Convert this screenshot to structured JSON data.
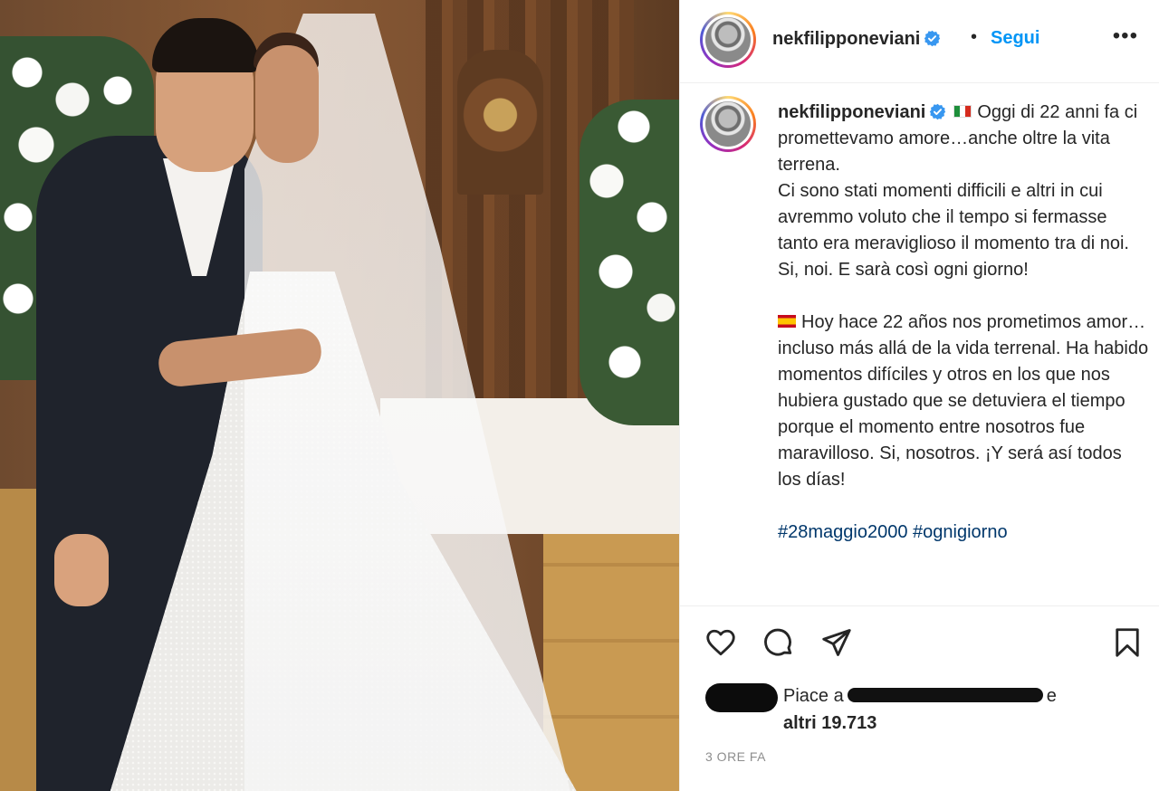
{
  "post": {
    "username": "nekfilipponeviani",
    "separator": "•",
    "follow_label": "Segui",
    "more_label": "•••"
  },
  "caption": {
    "username": "nekfilipponeviani",
    "flag_it": "italy-flag-icon",
    "it_lines": [
      "Oggi di 22 anni fa ci promettevamo amore…anche oltre la vita terrena.",
      "Ci sono stati momenti difficili e altri in cui avremmo voluto che il tempo si fermasse tanto era meraviglioso il momento tra di noi. Si, noi. E sarà così ogni giorno!"
    ],
    "flag_es": "spain-flag-icon",
    "es_text": "Hoy hace 22 años nos prometimos amor… incluso más allá de la vida terrenal. Ha habido momentos difíciles y otros en los que nos hubiera gustado que se detuviera el tiempo porque el momento entre nosotros fue maravilloso. Si, nosotros. ¡Y será así todos los días!",
    "hashtags": [
      "#28maggio2000",
      "#ognigiorno"
    ]
  },
  "likes": {
    "prefix": "Piace a",
    "suffix": "e",
    "others": "altri 19.713"
  },
  "timestamp": "3 ORE FA",
  "colors": {
    "accent": "#0095f6",
    "hashtag": "#00376b",
    "text": "#262626",
    "muted": "#8e8e8e",
    "verified": "#3897f0"
  }
}
